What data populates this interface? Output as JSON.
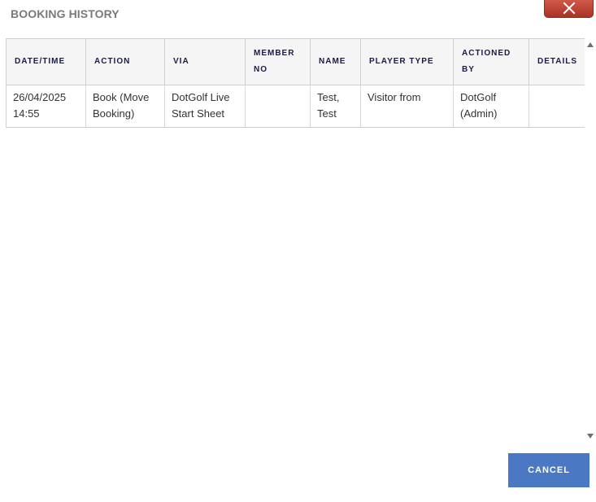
{
  "dialog": {
    "title": "BOOKING HISTORY",
    "close_icon": "close-x-icon",
    "cancel_label": "CANCEL"
  },
  "table": {
    "columns": [
      "DATE/TIME",
      "ACTION",
      "VIA",
      "MEMBER NO",
      "NAME",
      "PLAYER TYPE",
      "ACTIONED BY",
      "DETAILS"
    ],
    "rows": [
      {
        "datetime": "26/04/2025 14:55",
        "action": "Book (Move Booking)",
        "via": "DotGolf Live Start Sheet",
        "member_no": "",
        "name": "Test, Test",
        "player_type": "Visitor from",
        "actioned_by": "DotGolf (Admin)",
        "details": ""
      }
    ]
  },
  "colors": {
    "header_text": "#1a1a4e",
    "close_button": "#b8412f",
    "cancel_button": "#4a78c2"
  }
}
